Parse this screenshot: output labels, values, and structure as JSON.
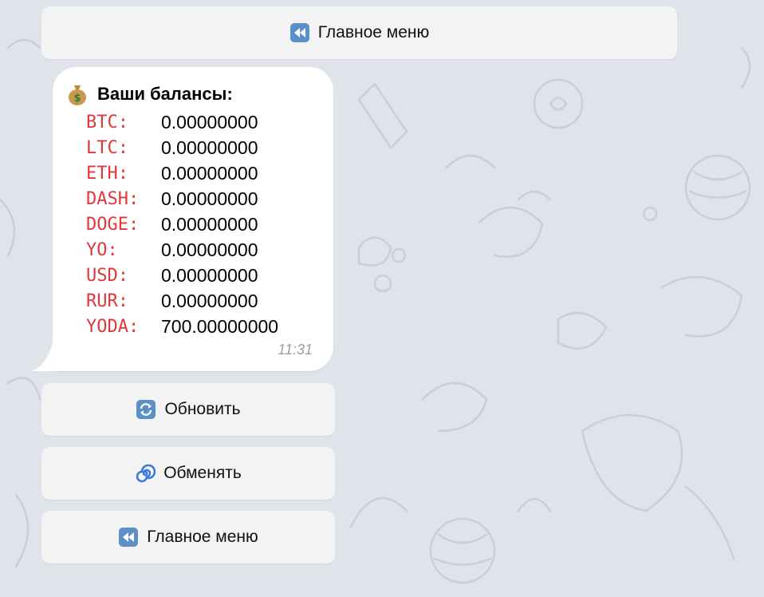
{
  "top_keyboard": {
    "main_menu_label": "Главное меню",
    "main_menu_icon": "rewind-icon"
  },
  "message": {
    "title_icon": "money-bag-icon",
    "title": "Ваши балансы:",
    "balances": [
      {
        "coin": "BTC:",
        "amount": "0.00000000"
      },
      {
        "coin": "LTC:",
        "amount": "0.00000000"
      },
      {
        "coin": "ETH:",
        "amount": "0.00000000"
      },
      {
        "coin": "DASH:",
        "amount": "0.00000000"
      },
      {
        "coin": "DOGE:",
        "amount": "0.00000000"
      },
      {
        "coin": "YO:",
        "amount": "0.00000000"
      },
      {
        "coin": "USD:",
        "amount": "0.00000000"
      },
      {
        "coin": "RUR:",
        "amount": "0.00000000"
      },
      {
        "coin": "YODA:",
        "amount": "700.00000000"
      }
    ],
    "time": "11:31"
  },
  "inline_keyboard": {
    "refresh": {
      "label": "Обновить",
      "icon": "refresh-icon"
    },
    "exchange": {
      "label": "Обменять",
      "icon": "cyclone-icon"
    },
    "main_menu": {
      "label": "Главное меню",
      "icon": "rewind-icon"
    }
  },
  "colors": {
    "background": "#dfe3ea",
    "coin_label": "#e0383b",
    "button_bg": "#f3f3f4",
    "icon_blue": "#4a7fb8"
  }
}
